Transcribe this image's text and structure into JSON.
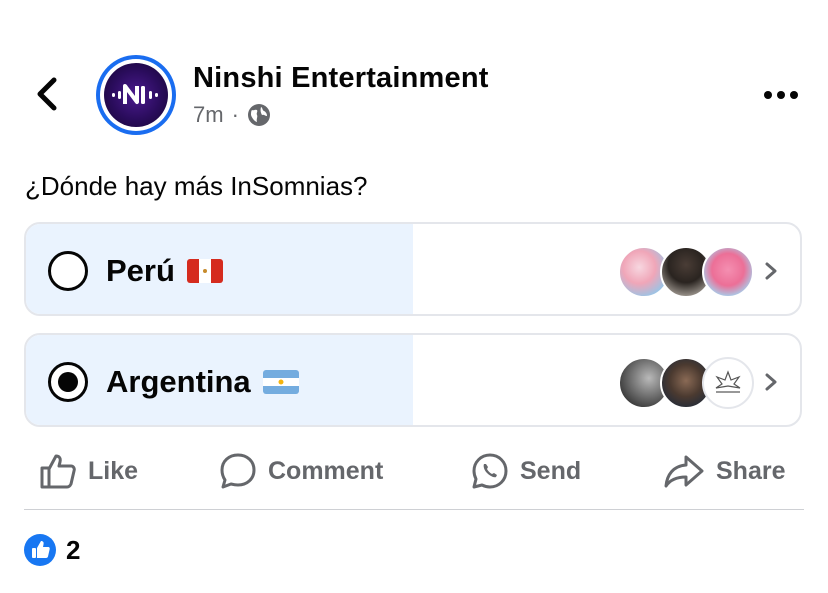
{
  "header": {
    "page_name": "Ninshi Entertainment",
    "time": "7m",
    "separator": "·",
    "audience_icon": "globe-icon",
    "back_icon": "chevron-left-icon",
    "more_icon": "more-dots-icon"
  },
  "post": {
    "text": "¿Dónde hay más InSomnias?"
  },
  "poll": {
    "options": [
      {
        "label": "Perú",
        "flag": "peru-flag",
        "selected": false,
        "vote_fraction": 0.5
      },
      {
        "label": "Argentina",
        "flag": "argentina-flag",
        "selected": true,
        "vote_fraction": 0.5
      }
    ]
  },
  "actions": [
    {
      "label": "Like",
      "icon": "thumbs-up-icon"
    },
    {
      "label": "Comment",
      "icon": "comment-bubble-icon"
    },
    {
      "label": "Send",
      "icon": "whatsapp-icon"
    },
    {
      "label": "Share",
      "icon": "share-arrow-icon"
    }
  ],
  "reactions": {
    "count": "2",
    "icon": "like-reaction-icon"
  },
  "colors": {
    "accent": "#1877f2",
    "poll_fill": "#eaf3fe",
    "muted": "#65676b"
  }
}
